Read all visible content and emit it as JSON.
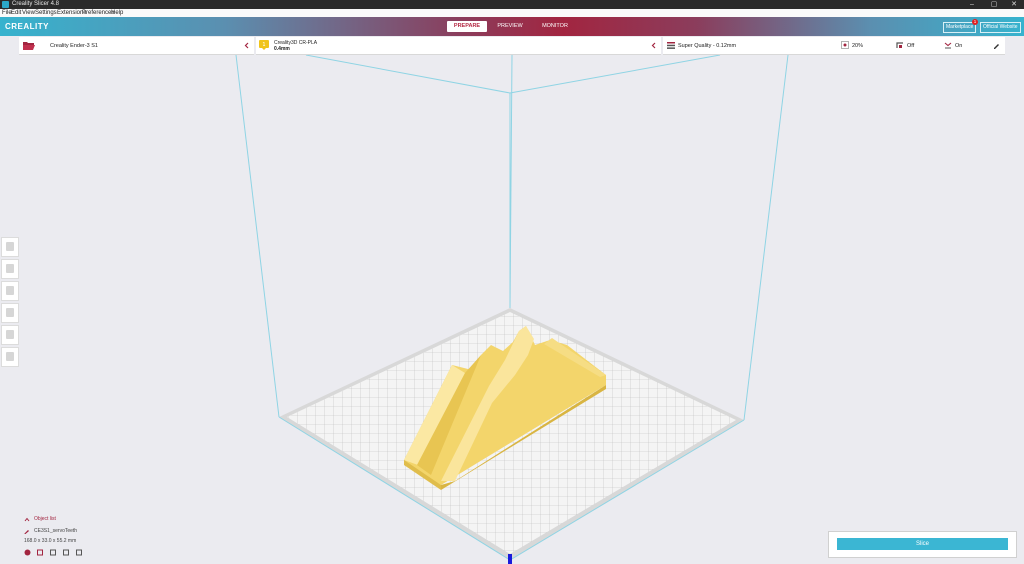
{
  "window": {
    "title": "Creality Slicer 4.8",
    "minimize": "–",
    "maximize": "▢",
    "close": "✕"
  },
  "menu": [
    "File",
    "Edit",
    "View",
    "Settings",
    "Extensions",
    "Preferences",
    "Help"
  ],
  "header": {
    "logo": "CREALITY",
    "tabs": [
      "PREPARE",
      "PREVIEW",
      "MONITOR"
    ],
    "active_tab": "PREPARE",
    "marketplace": "Marketplace",
    "marketplace_badge": "1",
    "official_website": "Official Website"
  },
  "printer": {
    "name": "Creality Ender-3 S1"
  },
  "material": {
    "name": "Creality3D CR-PLA",
    "nozzle": "0.4mm"
  },
  "print_settings": {
    "profile": "Super Quality - 0.12mm",
    "infill": "20%",
    "support": "Off",
    "adhesion": "On"
  },
  "object_list": {
    "title": "Object list",
    "file": "CE3S1_servoTeeth",
    "dimensions": "168.0 x 33.0 x 55.2 mm"
  },
  "slice": {
    "label": "Slice"
  },
  "colors": {
    "accent": "#3bb6d3",
    "brand": "#a22540",
    "model": "#f5dc7a"
  }
}
